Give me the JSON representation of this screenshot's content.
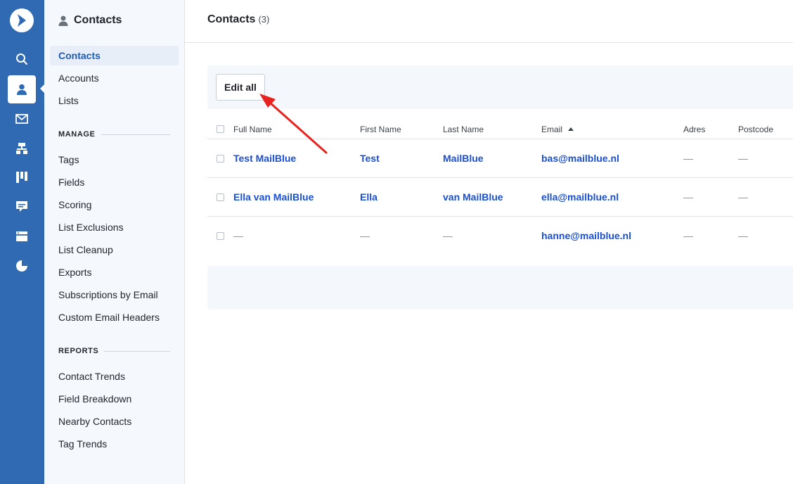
{
  "rail": {
    "items": [
      {
        "name": "search-icon",
        "active": false
      },
      {
        "name": "contacts-icon",
        "active": true
      },
      {
        "name": "email-icon",
        "active": false
      },
      {
        "name": "automation-icon",
        "active": false
      },
      {
        "name": "deals-pipeline-icon",
        "active": false
      },
      {
        "name": "conversations-icon",
        "active": false
      },
      {
        "name": "website-icon",
        "active": false
      },
      {
        "name": "reports-icon",
        "active": false
      }
    ]
  },
  "sidebar": {
    "title": "Contacts",
    "nav": [
      {
        "label": "Contacts",
        "active": true
      },
      {
        "label": "Accounts"
      },
      {
        "label": "Lists"
      }
    ],
    "manage_heading": "MANAGE",
    "manage": [
      {
        "label": "Tags"
      },
      {
        "label": "Fields"
      },
      {
        "label": "Scoring"
      },
      {
        "label": "List Exclusions"
      },
      {
        "label": "List Cleanup"
      },
      {
        "label": "Exports"
      },
      {
        "label": "Subscriptions by Email"
      },
      {
        "label": "Custom Email Headers"
      }
    ],
    "reports_heading": "REPORTS",
    "reports": [
      {
        "label": "Contact Trends"
      },
      {
        "label": "Field Breakdown"
      },
      {
        "label": "Nearby Contacts"
      },
      {
        "label": "Tag Trends"
      }
    ]
  },
  "main": {
    "title": "Contacts",
    "count": "(3)",
    "edit_all_label": "Edit all",
    "table": {
      "headers": [
        "Full Name",
        "First Name",
        "Last Name",
        "Email",
        "Adres",
        "Postcode"
      ],
      "sorted_by": "Email",
      "rows": [
        {
          "full_name": "Test MailBlue",
          "first_name": "Test",
          "last_name": "MailBlue",
          "email": "bas@mailblue.nl",
          "adres": "—",
          "postcode": "—"
        },
        {
          "full_name": "Ella van MailBlue",
          "first_name": "Ella",
          "last_name": "van MailBlue",
          "email": "ella@mailblue.nl",
          "adres": "—",
          "postcode": "—"
        },
        {
          "full_name": "—",
          "first_name": "—",
          "last_name": "—",
          "email": "hanne@mailblue.nl",
          "adres": "—",
          "postcode": "—"
        }
      ]
    }
  },
  "colors": {
    "rail": "#2f6ab3",
    "link": "#1b4fd1",
    "annotation_arrow": "#e8231f"
  }
}
